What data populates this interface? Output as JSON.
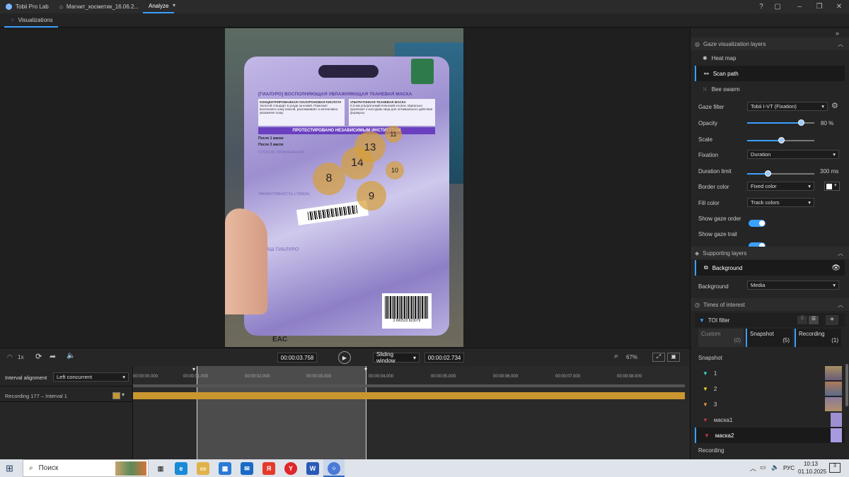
{
  "titlebar": {
    "app_name": "Tobii Pro Lab",
    "project_tab": "Магнит_косметик_16.06.2...",
    "analyze_tab": "Analyze",
    "icons": [
      "help-icon",
      "feedback-icon",
      "minimize-icon",
      "maximize-icon",
      "close-icon"
    ]
  },
  "toolbar": {
    "visualizations_label": "Visualizations"
  },
  "viewer": {
    "fixations": [
      {
        "label": "8"
      },
      {
        "label": "14"
      },
      {
        "label": "13"
      },
      {
        "label": "11"
      },
      {
        "label": "10"
      },
      {
        "label": "9"
      }
    ],
    "pack_texts": {
      "headline": "[ГИАЛУРО] ВОСПОЛНЯЮЩАЯ УВЛАЖНЯЮЩАЯ ТКАНЕВАЯ МАСКА",
      "col1_title": "КОНЦЕНТРИРОВАННАЯ ГИАЛУРОНОВАЯ КИСЛОТА",
      "col1_text": "Золотой стандарт в уходе за кожей. Помогает восполнить кожу влагой, разглаживает и интенсивно увлажняет кожу.",
      "col2_title": "УЛЬТРАТОНКАЯ ТКАНЕВАЯ МАСКА",
      "col2_text": "0,3 мм ультратонкий японский хлопок. Идеально прилегает к контурам лица для оптимального действия формулы.",
      "banner": "ПРОТЕСТИРОВАНО НЕЗАВИСИМЫМ ИНСТИТУТОМ",
      "after1": "После 1 маски",
      "after3": "После 3 масок",
      "method": "СПОСОБ ПРИМЕНЕНИЯ",
      "effect": "ЭФФЕКТИВНОСТЬ L'ORÉAL",
      "series": "ВАШ ГИАЛУРО",
      "barcode_num": "3 600523 823079"
    }
  },
  "controls": {
    "speed": "1x",
    "current_time": "00:00:03.758",
    "window_mode": "Sliding window",
    "window_length": "00:00:02.734",
    "zoom": "67%"
  },
  "timeline": {
    "interval_alignment_label": "Interval alignment",
    "alignment_value": "Left concurrent",
    "recording_label": "Recording 177 – Interval 1",
    "ticks": [
      "00:00:00.000",
      "00:00:01.000",
      "00:00:02.000",
      "00:00:03.000",
      "00:00:04.000",
      "00:00:05.000",
      "00:00:06.000",
      "00:00:07.000",
      "00:00:08.000"
    ]
  },
  "panel": {
    "gaze_header": "Gaze visualization layers",
    "layers": [
      {
        "label": "Heat map",
        "icon": "heatmap-icon"
      },
      {
        "label": "Scan path",
        "icon": "scanpath-icon",
        "selected": true
      },
      {
        "label": "Bee swarm",
        "icon": "beeswarm-icon"
      }
    ],
    "gaze_filter_label": "Gaze filter",
    "gaze_filter_value": "Tobii I-VT (Fixation)",
    "opacity_label": "Opacity",
    "opacity_value": "80 %",
    "opacity_level": 0.8,
    "scale_label": "Scale",
    "scale_level": 0.5,
    "fixation_label": "Fixation",
    "fixation_value": "Duration",
    "duration_limit_label": "Duration limit",
    "duration_limit_value": "300 ms",
    "duration_level": 0.3,
    "border_color_label": "Border color",
    "border_color_value": "Fixed color",
    "fill_color_label": "Fill color",
    "fill_color_value": "Track colors",
    "show_gaze_order_label": "Show gaze order",
    "show_gaze_trail_label": "Show gaze trail",
    "supporting_header": "Supporting layers",
    "background_layer_label": "Background",
    "background_label": "Background",
    "background_value": "Media",
    "toi_header": "Times of interest",
    "toi_filter_label": "TOI filter",
    "toi_cols": [
      {
        "label": "Custom",
        "count": "(0)"
      },
      {
        "label": "Snapshot",
        "count": "(5)"
      },
      {
        "label": "Recording",
        "count": "(1)"
      }
    ],
    "snapshot_header": "Snapshot",
    "snapshots": [
      {
        "label": "1",
        "color": "#3ad6c4"
      },
      {
        "label": "2",
        "color": "#e0d92a"
      },
      {
        "label": "3",
        "color": "#e0963a"
      },
      {
        "label": "маска1",
        "color": "#c0384a"
      },
      {
        "label": "маска2",
        "color": "#c0384a"
      }
    ],
    "recording_header": "Recording"
  },
  "taskbar": {
    "search_label": "Поиск",
    "lang": "РУС",
    "time": "10:13",
    "date": "01.10.2025",
    "notif_count": "3"
  },
  "colors": {
    "accent": "#3aa0ff",
    "interval": "#c9962f"
  }
}
